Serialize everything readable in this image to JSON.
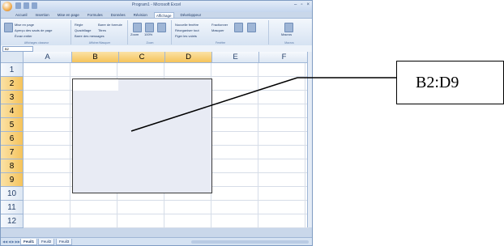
{
  "window": {
    "title": "Program1 - Microsoft Excel",
    "quick_access": [
      "save-icon",
      "undo-icon",
      "redo-icon"
    ],
    "controls": [
      "–",
      "▫",
      "×"
    ]
  },
  "ribbon": {
    "tabs": [
      "Accueil",
      "Insertion",
      "Mise en page",
      "Formules",
      "Données",
      "Révision",
      "Affichage",
      "Développeur"
    ],
    "active_tab": "Affichage",
    "groups": [
      {
        "label": "Affichages classeur",
        "items": [
          "Mise en page",
          "Aperçu des sauts de page",
          "Écran entier"
        ]
      },
      {
        "label": "Afficher/Masquer",
        "items": [
          "Règle",
          "Quadrillage",
          "Barre de formule",
          "Titres",
          "Barre des messages"
        ]
      },
      {
        "label": "Zoom",
        "items": [
          "Zoom",
          "100%",
          "Zoom sur la sélection"
        ]
      },
      {
        "label": "Fenêtre",
        "items": [
          "Nouvelle fenêtre",
          "Réorganiser tout",
          "Figer les volets",
          "Fractionner",
          "Masquer"
        ]
      },
      {
        "label": "Macros",
        "items": [
          "Macros"
        ]
      }
    ]
  },
  "name_box": "B2",
  "columns": [
    "A",
    "B",
    "C",
    "D",
    "E",
    "F"
  ],
  "selected_columns": [
    "B",
    "C",
    "D"
  ],
  "rows": [
    "1",
    "2",
    "3",
    "4",
    "5",
    "6",
    "7",
    "8",
    "9",
    "10",
    "11",
    "12"
  ],
  "selected_rows": [
    "2",
    "3",
    "4",
    "5",
    "6",
    "7",
    "8",
    "9"
  ],
  "sheets": [
    "Feuil1",
    "Feuil2",
    "Feuil3"
  ],
  "active_sheet": "Feuil1",
  "callout": {
    "text": "B2:D9"
  },
  "colors": {
    "selection_fill": "#e8ebf4",
    "header_selected": "#f5c35b",
    "frame": "#7f9cc2"
  }
}
